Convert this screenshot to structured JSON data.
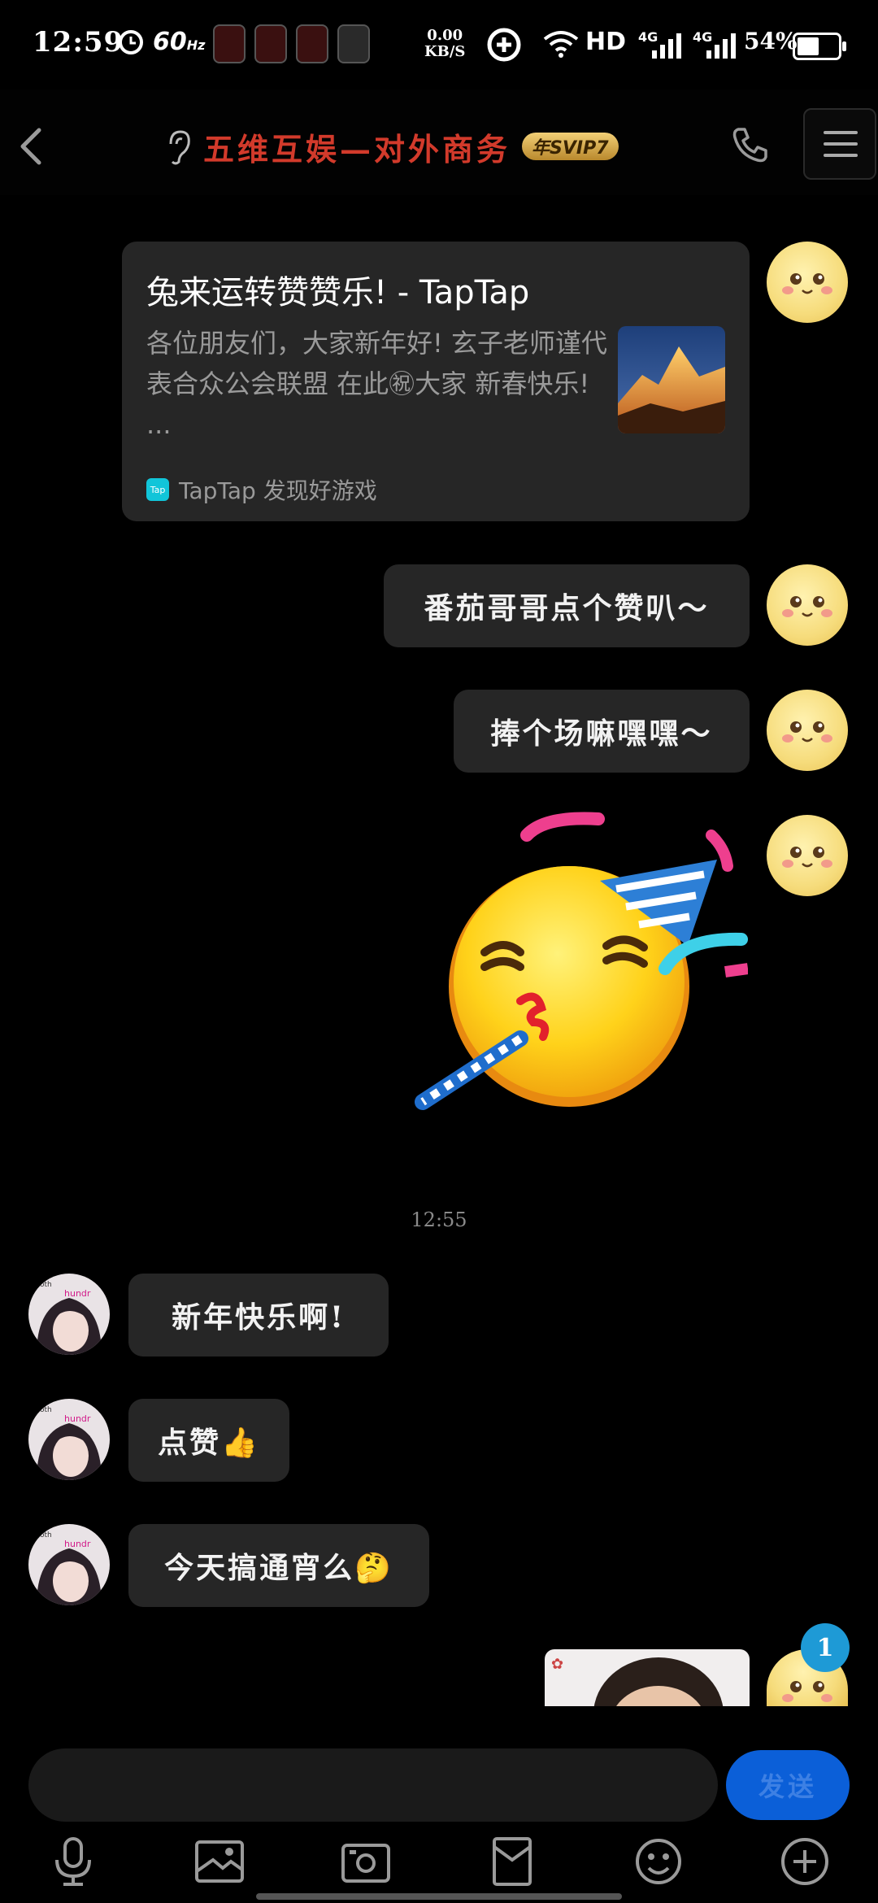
{
  "status_bar": {
    "time": "12:59",
    "refresh_rate": "60",
    "refresh_unit": "Hz",
    "net_speed": "0.00",
    "net_unit": "KB/S",
    "hd_label": "HD",
    "sim1_label": "4G",
    "sim2_label": "4G",
    "battery_pct": "54%",
    "battery_level": 0.54
  },
  "header": {
    "title": "五维互娱—对外商务",
    "badge": "年SVIP7"
  },
  "link_card": {
    "title": "兔来运转赞赞乐! - TapTap",
    "description": "各位朋友们，大家新年好! 玄子老师谨代表合众公会联盟 在此㊗大家 新春快乐! ...",
    "source": "TapTap 发现好游戏",
    "source_logo": "Tap"
  },
  "messages_outgoing": [
    {
      "text": "番茄哥哥点个赞叭～"
    },
    {
      "text": "捧个场嘛嘿嘿～"
    }
  ],
  "timestamp": "12:55",
  "messages_incoming": [
    {
      "text": "新年快乐啊!"
    },
    {
      "text": "点赞👍"
    },
    {
      "text": "今天搞通宵么🤔"
    }
  ],
  "unread_badge": "1",
  "composer": {
    "input_value": "",
    "send_label": "发送"
  },
  "toolbar_icons": [
    "microphone-icon",
    "image-icon",
    "camera-icon",
    "file-icon",
    "emoji-icon",
    "plus-icon"
  ],
  "colors": {
    "title_red": "#d23a2b",
    "bubble": "#262626",
    "send_blue": "#0b5fd8",
    "badge_blue": "#1e9ad6"
  }
}
